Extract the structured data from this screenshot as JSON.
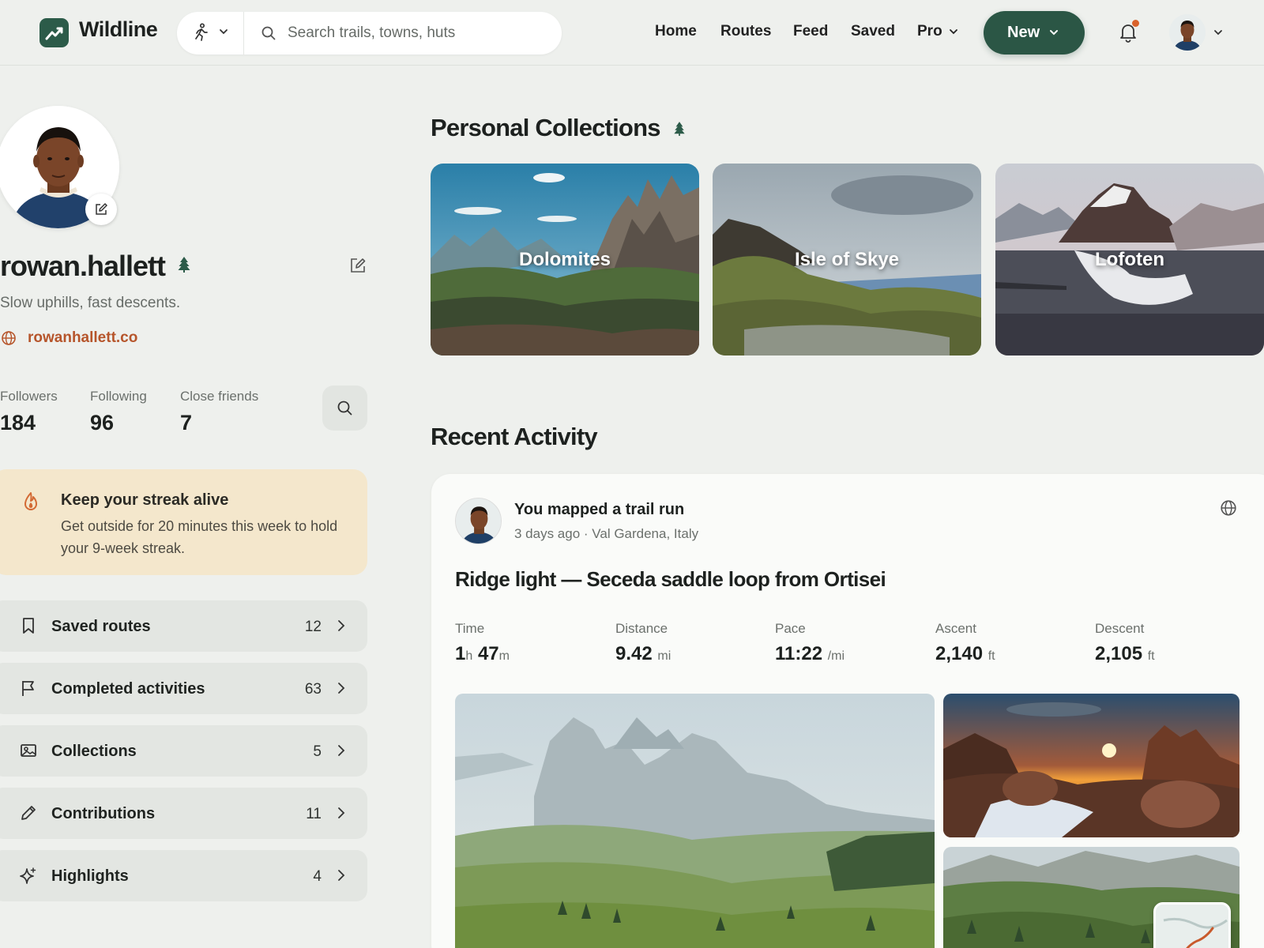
{
  "app": {
    "name": "Wildline",
    "accent": "#2b5645",
    "link_color": "#b6552b"
  },
  "search": {
    "placeholder": "Search trails, towns, huts",
    "mode_icon": "runner-icon"
  },
  "nav": {
    "home": "Home",
    "routes": "Routes",
    "feed": "Feed",
    "saved": "Saved",
    "pro": "Pro",
    "new_button": "New"
  },
  "profile": {
    "username": "rowan.hallett",
    "bio": "Slow uphills, fast descents.",
    "website": "rowanhallett.co",
    "stats": [
      {
        "label": "Followers",
        "value": "184"
      },
      {
        "label": "Following",
        "value": "96"
      },
      {
        "label": "Close friends",
        "value": "7"
      }
    ]
  },
  "streak": {
    "title": "Keep your streak alive",
    "text": "Get outside for 20 minutes this week to hold your 9-week streak."
  },
  "menu": [
    {
      "label": "Saved routes",
      "count": "12",
      "icon": "bookmark-icon"
    },
    {
      "label": "Completed activities",
      "count": "63",
      "icon": "flag-icon"
    },
    {
      "label": "Collections",
      "count": "5",
      "icon": "image-icon"
    },
    {
      "label": "Contributions",
      "count": "11",
      "icon": "pencil-icon"
    },
    {
      "label": "Highlights",
      "count": "4",
      "icon": "sparkle-icon"
    }
  ],
  "collections": {
    "title": "Personal Collections",
    "items": [
      {
        "label": "Dolomites"
      },
      {
        "label": "Isle of Skye"
      },
      {
        "label": "Lofoten"
      }
    ]
  },
  "activity": {
    "section_title": "Recent Activity",
    "headline": "You mapped a trail run",
    "meta": "3 days ago · Val Gardena, Italy",
    "title": "Ridge light — Seceda saddle loop from Ortisei",
    "metrics": {
      "time": {
        "label": "Time",
        "h": "1",
        "h_unit": "h",
        "m": "47",
        "m_unit": "m"
      },
      "distance": {
        "label": "Distance",
        "value": "9.42",
        "unit": "mi"
      },
      "pace": {
        "label": "Pace",
        "value": "11:22",
        "unit": "/mi"
      },
      "ascent": {
        "label": "Ascent",
        "value": "2,140",
        "unit": "ft"
      },
      "descent": {
        "label": "Descent",
        "value": "2,105",
        "unit": "ft"
      }
    }
  }
}
